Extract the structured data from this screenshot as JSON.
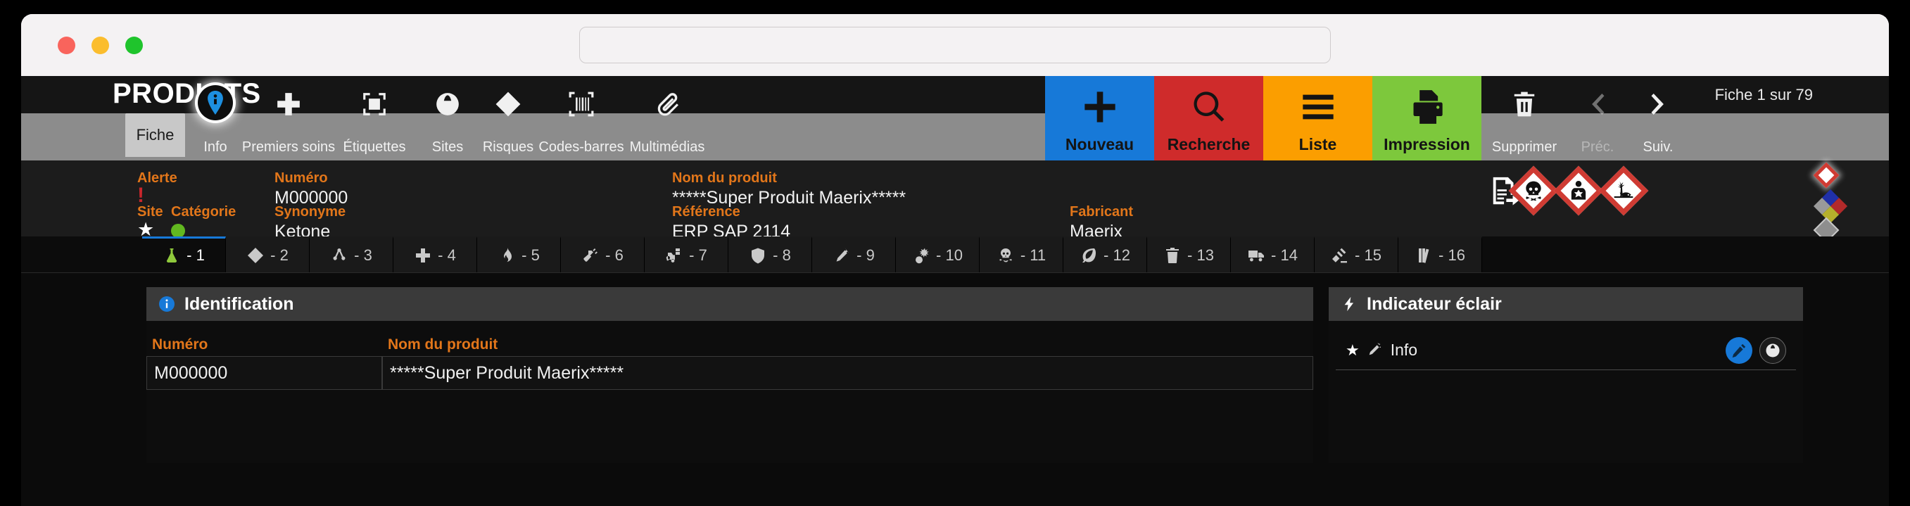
{
  "browser": {
    "traffic_lights": [
      "close",
      "minimize",
      "maximize"
    ],
    "address_value": "",
    "address_placeholder": ""
  },
  "header": {
    "app_title": "PRODUITS",
    "record_counter_prefix": "Fiche",
    "record_counter_current": "1",
    "record_counter_middle": "sur",
    "record_counter_total": "79",
    "record_counter_full": "Fiche 1 sur 79"
  },
  "nav": {
    "active_section": "Fiche",
    "section_label": "Fiche",
    "items": [
      {
        "label": "Info",
        "icon": "info-pin-icon",
        "active": true
      },
      {
        "label": "Premiers soins",
        "icon": "first-aid-cross-icon",
        "active": false
      },
      {
        "label": "Étiquettes",
        "icon": "label-tag-icon",
        "active": false
      },
      {
        "label": "Sites",
        "icon": "globe-pin-icon",
        "active": false
      },
      {
        "label": "Risques",
        "icon": "warning-diamond-icon",
        "active": false
      },
      {
        "label": "Codes-barres",
        "icon": "barcode-icon",
        "active": false
      },
      {
        "label": "Multimédias",
        "icon": "paperclip-icon",
        "active": false
      }
    ],
    "actions": [
      {
        "label": "Nouveau",
        "icon": "plus-icon",
        "color": "#1779d8"
      },
      {
        "label": "Recherche",
        "icon": "magnifier-icon",
        "color": "#cf2b2b"
      },
      {
        "label": "Liste",
        "icon": "list-lines-icon",
        "color": "#fb9e00"
      },
      {
        "label": "Impression",
        "icon": "printer-icon",
        "color": "#7dc83c"
      }
    ],
    "right_items": [
      {
        "label": "Supprimer",
        "icon": "trash-icon",
        "disabled": false
      },
      {
        "label": "Préc.",
        "icon": "chevron-left-icon",
        "disabled": true
      },
      {
        "label": "Suiv.",
        "icon": "chevron-right-icon",
        "disabled": false
      }
    ]
  },
  "info_strip": {
    "alerte_label": "Alerte",
    "alerte_value": "!",
    "site_label": "Site",
    "site_value": "★",
    "categorie_label": "Catégorie",
    "categorie_value": "",
    "numero_label": "Numéro",
    "numero_value": "M000000",
    "synonyme_label": "Synonyme",
    "synonyme_value": "Ketone",
    "nom_produit_label": "Nom du produit",
    "nom_produit_value": "*****Super Produit Maerix*****",
    "reference_label": "Référence",
    "reference_value": "ERP SAP 2114",
    "fabricant_label": "Fabricant",
    "fabricant_value": "Maerix",
    "fds_icon": "fds-document-icon",
    "ghs_pictograms": [
      {
        "name": "ghs-skull-crossbones",
        "icon": "skull-icon"
      },
      {
        "name": "ghs-health-hazard",
        "icon": "health-hazard-icon"
      },
      {
        "name": "ghs-environment",
        "icon": "dead-tree-fish-icon"
      }
    ],
    "diamond_indicators": [
      {
        "name": "ghs-diamond-indicator",
        "color": "#cf3b33"
      },
      {
        "name": "nfpa-704-diamond",
        "colors": {
          "blue": "#2030a8",
          "red": "#b22a2a",
          "yellow": "#b5b02c",
          "white": "#9a9a9a"
        }
      },
      {
        "name": "gray-diamond-indicator",
        "color": "#8e8e8e"
      }
    ]
  },
  "tabs": [
    {
      "num": "- 1",
      "icon": "flask-green-icon",
      "active": true
    },
    {
      "num": "- 2",
      "icon": "warning-diamond-icon",
      "active": false
    },
    {
      "num": "- 3",
      "icon": "molecule-icon",
      "active": false
    },
    {
      "num": "- 4",
      "icon": "first-aid-cross-icon",
      "active": false
    },
    {
      "num": "- 5",
      "icon": "flame-icon",
      "active": false
    },
    {
      "num": "- 6",
      "icon": "spray-bottle-icon",
      "active": false
    },
    {
      "num": "- 7",
      "icon": "forklift-icon",
      "active": false
    },
    {
      "num": "- 8",
      "icon": "shield-icon",
      "active": false
    },
    {
      "num": "- 9",
      "icon": "test-tube-icon",
      "active": false
    },
    {
      "num": "- 10",
      "icon": "explosion-icon",
      "active": false
    },
    {
      "num": "- 11",
      "icon": "skull-icon",
      "active": false
    },
    {
      "num": "- 12",
      "icon": "leaf-icon",
      "active": false
    },
    {
      "num": "- 13",
      "icon": "trash-icon",
      "active": false
    },
    {
      "num": "- 14",
      "icon": "truck-icon",
      "active": false
    },
    {
      "num": "- 15",
      "icon": "gavel-icon",
      "active": false
    },
    {
      "num": "- 16",
      "icon": "books-icon",
      "active": false
    }
  ],
  "identification_panel": {
    "title": "Identification",
    "icon": "info-circle-icon",
    "fields": [
      {
        "label": "Numéro",
        "value": "M000000"
      },
      {
        "label": "Nom du produit",
        "value": "*****Super Produit Maerix*****"
      }
    ]
  },
  "indicateur_panel": {
    "title": "Indicateur éclair",
    "icon": "lightning-bolt-icon",
    "rows": [
      {
        "star": "★",
        "icon": "megaphone-icon",
        "label": "Info",
        "buttons": [
          {
            "name": "edit-button",
            "icon": "pencil-icon",
            "color": "#1779d8"
          },
          {
            "name": "web-button",
            "icon": "globe-icon",
            "color": "#1b1b1b"
          }
        ]
      }
    ]
  },
  "colors": {
    "accent_orange": "#e2761a",
    "accent_blue": "#1779d8",
    "accent_red": "#cf2b2b",
    "accent_yellow": "#fb9e00",
    "accent_green": "#7dc83c",
    "bg_dark": "#0b0b0b",
    "panel_head": "#3a3a3a"
  }
}
